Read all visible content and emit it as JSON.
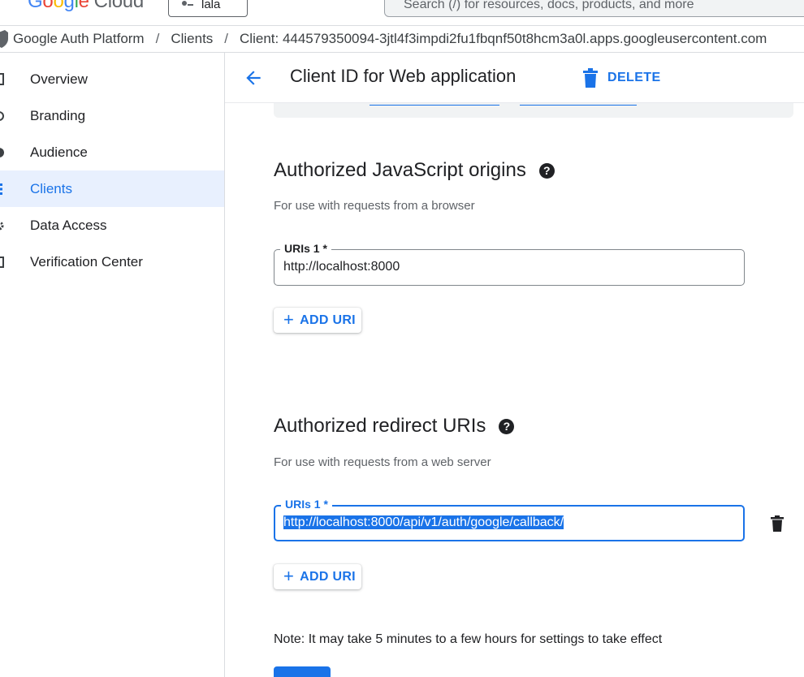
{
  "header": {
    "logo": {
      "g1": "G",
      "g2": "o",
      "g3": "o",
      "g4": "g",
      "g5": "l",
      "g6": "e",
      "cloud": "Cloud"
    },
    "project": "lala",
    "search_placeholder": "Search (/) for resources, docs, products, and more"
  },
  "breadcrumb": {
    "items": [
      "Google Auth Platform",
      "Clients",
      "Client:  444579350094-3jtl4f3impdi2fu1fbqnf50t8hcm3a0l.apps.googleusercontent.com"
    ],
    "separator": "/"
  },
  "sidebar": {
    "items": [
      {
        "label": "Overview",
        "icon": "dashboard-icon"
      },
      {
        "label": "Branding",
        "icon": "palette-icon"
      },
      {
        "label": "Audience",
        "icon": "people-icon"
      },
      {
        "label": "Clients",
        "icon": "key-icon",
        "active": true
      },
      {
        "label": "Data Access",
        "icon": "settings-icon"
      },
      {
        "label": "Verification Center",
        "icon": "verified-icon"
      }
    ]
  },
  "page": {
    "title": "Client ID for Web application",
    "delete_label": "DELETE"
  },
  "js_origins": {
    "title": "Authorized JavaScript origins",
    "help": "?",
    "description": "For use with requests from a browser",
    "field_label": "URIs 1 *",
    "value": "http://localhost:8000",
    "add_label": "ADD URI",
    "add_icon": "+"
  },
  "redirect_uris": {
    "title": "Authorized redirect URIs",
    "help": "?",
    "description": "For use with requests from a web server",
    "field_label": "URIs 1 *",
    "value": "http://localhost:8000/api/v1/auth/google/callback/",
    "add_label": "ADD URI",
    "add_icon": "+"
  },
  "note": "Note: It may take 5 minutes to a few hours for settings to take effect",
  "colors": {
    "accent": "#1a73e8",
    "active_nav_bg": "#e8f0fe",
    "text": "#202124",
    "muted": "#5f6368"
  }
}
